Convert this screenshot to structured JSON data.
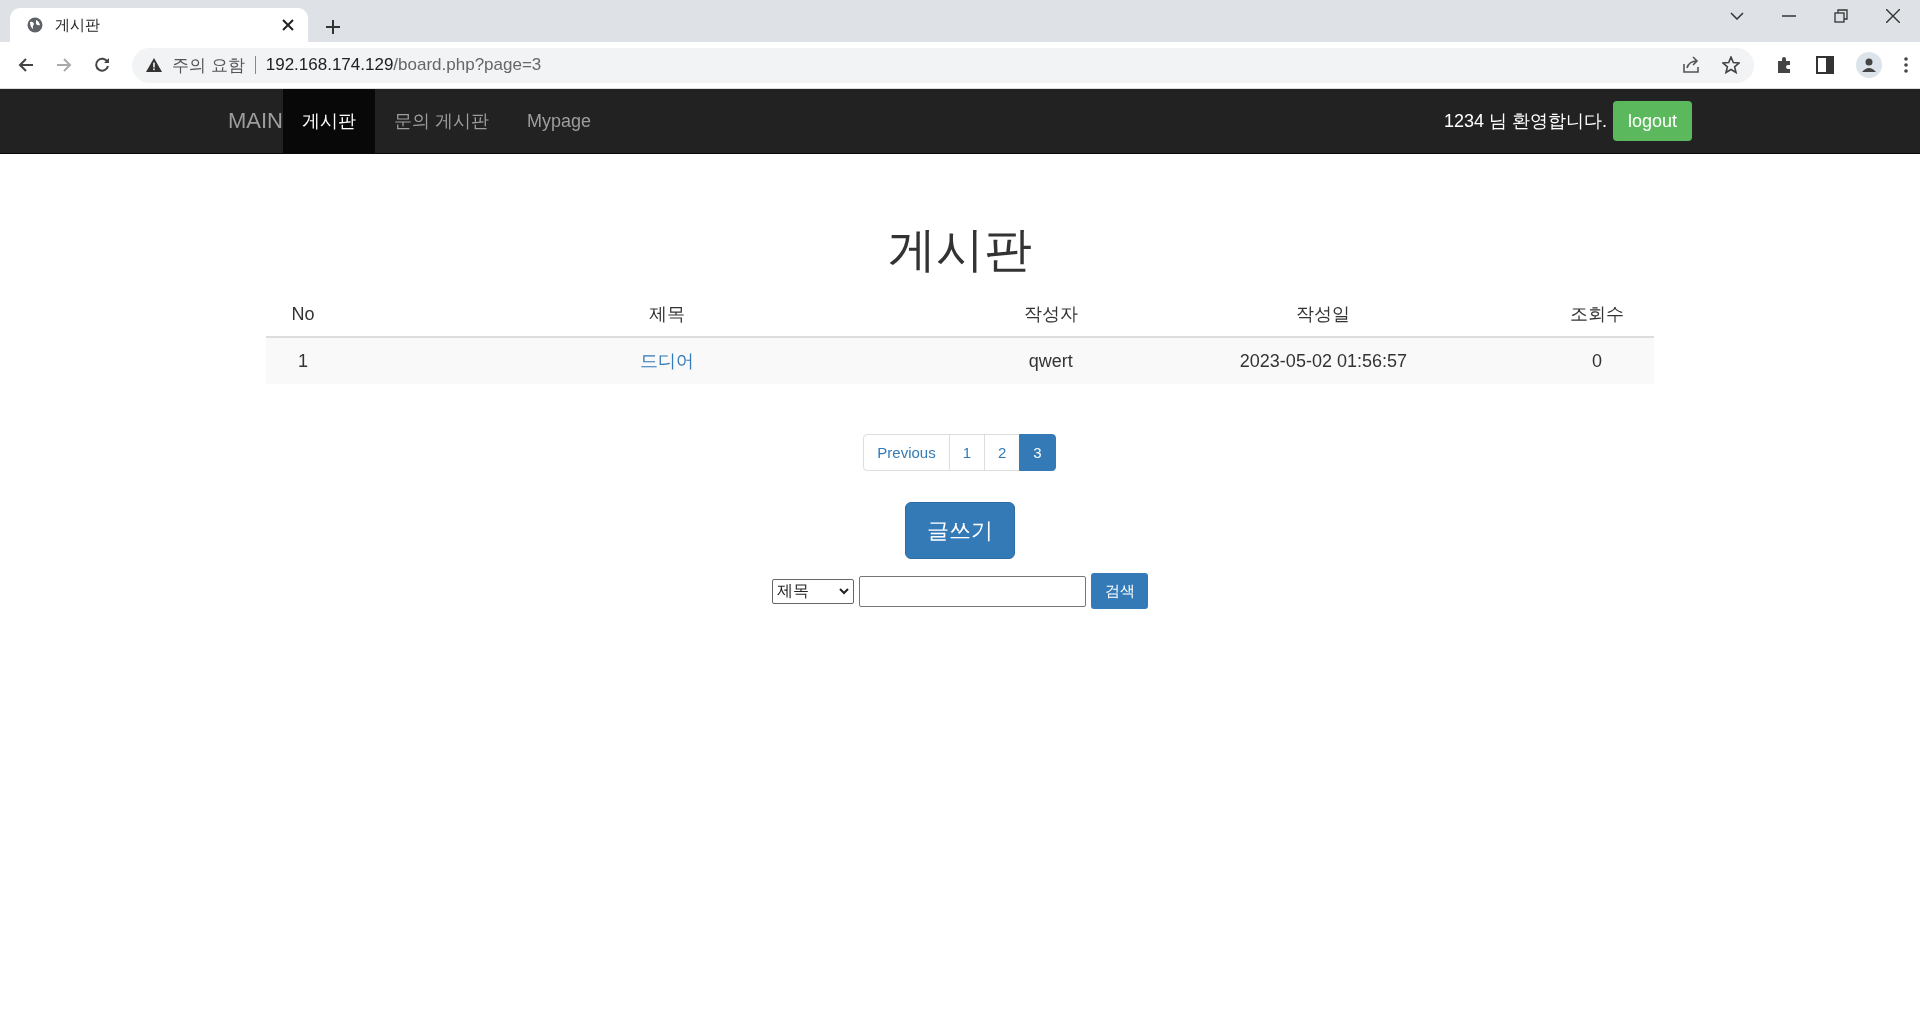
{
  "browser": {
    "tab_title": "게시판",
    "forward_disabled": true,
    "security_label": "주의 요함",
    "url_host": "192.168.174.129",
    "url_path": "/board.php?page=3"
  },
  "navbar": {
    "brand": "MAIN",
    "items": [
      {
        "label": "게시판",
        "selected": true
      },
      {
        "label": "문의 게시판",
        "selected": false
      },
      {
        "label": "Mypage",
        "selected": false
      }
    ],
    "welcome": "1234 님 환영합니다.",
    "logout": "logout"
  },
  "page_title": "게시판",
  "table": {
    "columns": [
      "No",
      "제목",
      "작성자",
      "작성일",
      "조회수"
    ],
    "rows": [
      {
        "no": "1",
        "title": "드디어",
        "author": "qwert",
        "date": "2023-05-02 01:56:57",
        "views": "0"
      }
    ]
  },
  "pagination": [
    {
      "label": "Previous",
      "selected": false
    },
    {
      "label": "1",
      "selected": false
    },
    {
      "label": "2",
      "selected": false
    },
    {
      "label": "3",
      "selected": true
    }
  ],
  "write_button": "글쓰기",
  "search": {
    "field": "제목",
    "button": "검색"
  }
}
